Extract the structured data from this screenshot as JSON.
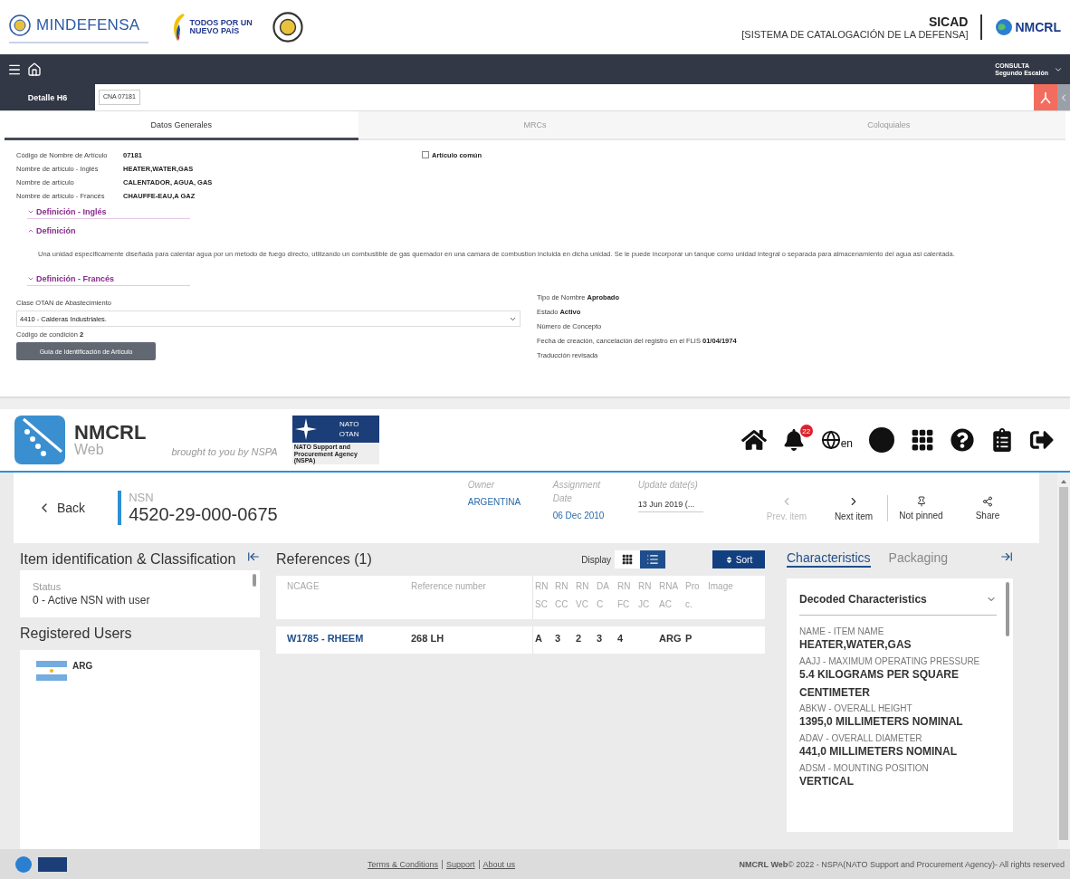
{
  "sicad_header": {
    "ministry": "MINDEFENSA",
    "campaign_lines": [
      "TODOS POR UN",
      "NUEVO PAÍS"
    ],
    "system_title": "SICAD",
    "system_subtitle": "[SISTEMA DE CATALOGACIÓN DE LA DEFENSA]",
    "partner": "NMCRL"
  },
  "nav_bar": {
    "role": "CONSULTA",
    "level": "Segundo Escalón"
  },
  "detail_bar": {
    "label": "Detalle H6",
    "code": "CNA 07181"
  },
  "tabs": [
    {
      "label": "Datos Generales",
      "selected": true
    },
    {
      "label": "MRCs",
      "selected": false
    },
    {
      "label": "Coloquiales",
      "selected": false
    }
  ],
  "fields": [
    {
      "label": "Código de Nombre de Artículo",
      "value": "07181"
    },
    {
      "label": "Nombre de artículo - Inglés",
      "value": "HEATER,WATER,GAS"
    },
    {
      "label": "Nombre de artículo",
      "value": "CALENTADOR, AGUA, GAS"
    },
    {
      "label": "Nombre de artículo - Francés",
      "value": "CHAUFFE-EAU,A GAZ"
    }
  ],
  "common_item": {
    "label": "Artículo común",
    "checked": false
  },
  "sections": [
    {
      "title": "Definición - Inglés",
      "expanded": false
    },
    {
      "title": "Definición",
      "expanded": true,
      "text": "Una unidad especificamente diseñada para calentar agua por un metodo de fuego directo, utilizando un combustible de gas quemador en una camara de combustion incluida en dicha unidad. Se le puede incorporar un tanque como unidad integral o separada para almacenamiento del agua asi calentada."
    },
    {
      "title": "Definición - Francés",
      "expanded": false
    }
  ],
  "supply_class": {
    "label": "Clase OTAN de Abastecimiento",
    "value": "4410 - Calderas Industriales."
  },
  "condition": {
    "label": "Código de condición",
    "value": "2"
  },
  "guide_button": "Guía de Identificación de Artículo",
  "status_fields": [
    {
      "label": "Tipo de Nombre",
      "value": "Aprobado"
    },
    {
      "label": "Estado",
      "value": "Activo"
    },
    {
      "label": "Número de Concepto"
    },
    {
      "label": "Fecha de creación, cancelación del registro en el FLIS",
      "value": "01/04/1974"
    },
    {
      "label": "Traducción revisada"
    }
  ],
  "nmcrl_header": {
    "brand": "NMCRL",
    "brand_sub": "Web",
    "tagline": "brought to you by NSPA",
    "nato_lines": [
      "NATO",
      "OTAN"
    ],
    "nato_caption": "NATO Support and Procurement Agency (NSPA)",
    "notifications": "22",
    "language": "en"
  },
  "item_bar": {
    "back": "Back",
    "nsn_label": "NSN",
    "nsn": "4520-29-000-0675",
    "meta": [
      {
        "label": "Owner",
        "value": "ARGENTINA"
      },
      {
        "label": "Assignment Date",
        "value": "06 Dec 2010"
      },
      {
        "label": "Update date(s)",
        "value": "13 Jun 2019 (..."
      }
    ],
    "actions": [
      {
        "kind": "prev",
        "label": "Prev. item",
        "disabled": true
      },
      {
        "kind": "next",
        "label": "Next item",
        "disabled": false
      },
      {
        "kind": "pin",
        "label": "Not pinned",
        "disabled": false
      },
      {
        "kind": "share",
        "label": "Share",
        "disabled": false
      }
    ]
  },
  "left_panel": {
    "title": "Item identification & Classification",
    "status_label": "Status",
    "status": "0 - Active NSN with user",
    "users_title": "Registered Users",
    "users": [
      {
        "code": "ARG"
      }
    ]
  },
  "references": {
    "title": "References (1)",
    "display_label": "Display",
    "views": [
      {
        "kind": "grid",
        "selected": false
      },
      {
        "kind": "list",
        "selected": true
      }
    ],
    "sort": "Sort",
    "columns": [
      "NCAGE",
      "Reference number",
      "RNSC",
      "RNCC",
      "RNVC",
      "DAC",
      "RNFC",
      "RNJC",
      "RNAAC",
      "Proc.",
      "Image"
    ],
    "rows": [
      {
        "cells": [
          "W1785 - RHEEM",
          "268 LH",
          "A",
          "3",
          "2",
          "3",
          "4",
          "",
          "ARG",
          "P",
          ""
        ]
      }
    ]
  },
  "right_panel": {
    "tabs": [
      {
        "label": "Characteristics",
        "selected": true
      },
      {
        "label": "Packaging",
        "selected": false
      }
    ],
    "section_title": "Decoded Characteristics",
    "characteristics": [
      {
        "name": "NAME - ITEM NAME",
        "value": "HEATER,WATER,GAS"
      },
      {
        "name": "AAJJ - MAXIMUM OPERATING PRESSURE",
        "value": "5.4 KILOGRAMS PER SQUARE CENTIMETER"
      },
      {
        "name": "ABKW - OVERALL HEIGHT",
        "value": "1395,0 MILLIMETERS NOMINAL"
      },
      {
        "name": "ADAV - OVERALL DIAMETER",
        "value": "441,0 MILLIMETERS NOMINAL"
      },
      {
        "name": "ADSM - MOUNTING POSITION",
        "value": "VERTICAL"
      }
    ]
  },
  "footer": {
    "links": [
      "Terms & Conditions",
      "Support",
      "About us"
    ],
    "copyright": "**NMCRL Web**© 2022 - NSPA(NATO Support and Procurement Agency)- All rights reserved"
  }
}
